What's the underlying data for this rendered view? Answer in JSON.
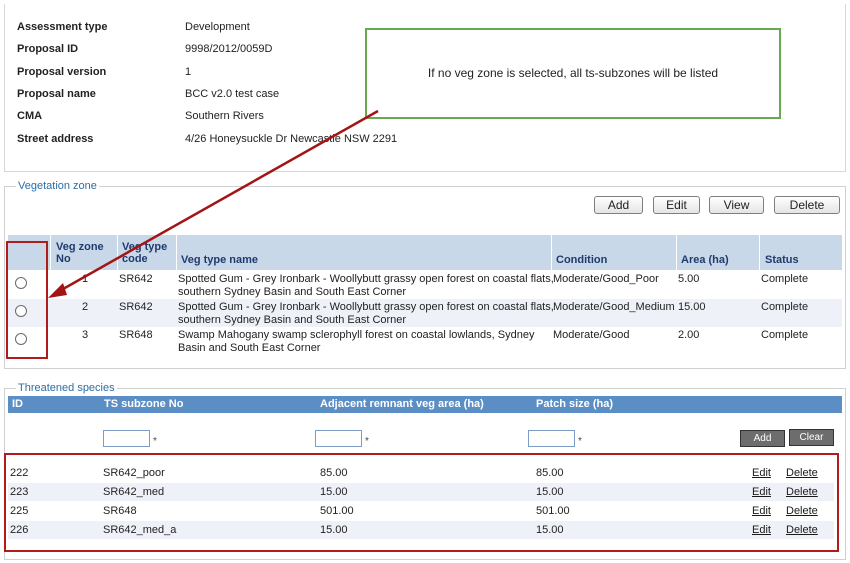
{
  "details": [
    {
      "label": "Assessment type",
      "value": "Development"
    },
    {
      "label": "Proposal ID",
      "value": "9998/2012/0059D"
    },
    {
      "label": "Proposal version",
      "value": "1"
    },
    {
      "label": "Proposal name",
      "value": "BCC v2.0 test case"
    },
    {
      "label": "CMA",
      "value": "Southern Rivers"
    },
    {
      "label": "Street address",
      "value": "4/26 Honeysuckle Dr Newcastle NSW 2291"
    }
  ],
  "callout": {
    "text": "If no veg zone is selected, all ts-subzones will be listed"
  },
  "veg_zone": {
    "legend": "Vegetation zone",
    "buttons": {
      "add": "Add",
      "edit": "Edit",
      "view": "View",
      "delete": "Delete"
    },
    "headers": {
      "zone_no": "Veg zone No",
      "type_code": "Veg type code",
      "type_name": "Veg type name",
      "condition": "Condition",
      "area": "Area (ha)",
      "status": "Status"
    },
    "rows": [
      {
        "zone_no": "1",
        "type_code": "SR642",
        "type_name_1": "Spotted Gum - Grey Ironbark - Woollybutt grassy open forest on coastal flats,",
        "type_name_2": "southern Sydney Basin and South East Corner",
        "condition": "Moderate/Good_Poor",
        "area": "5.00",
        "status": "Complete"
      },
      {
        "zone_no": "2",
        "type_code": "SR642",
        "type_name_1": "Spotted Gum - Grey Ironbark - Woollybutt grassy open forest on coastal flats,",
        "type_name_2": "southern Sydney Basin and South East Corner",
        "condition": "Moderate/Good_Medium",
        "area": "15.00",
        "status": "Complete"
      },
      {
        "zone_no": "3",
        "type_code": "SR648",
        "type_name_1": "Swamp Mahogany swamp sclerophyll forest on coastal lowlands, Sydney",
        "type_name_2": "Basin and South East Corner",
        "condition": "Moderate/Good",
        "area": "2.00",
        "status": "Complete"
      }
    ]
  },
  "threatened": {
    "legend": "Threatened species",
    "headers": {
      "id": "ID",
      "subzone": "TS subzone No",
      "adjacent": "Adjacent remnant veg area (ha)",
      "patch": "Patch size (ha)"
    },
    "filter": {
      "required_mark": "*",
      "add": "Add",
      "clear": "Clear"
    },
    "rows": [
      {
        "id": "222",
        "subzone": "SR642_poor",
        "adjacent": "85.00",
        "patch": "85.00"
      },
      {
        "id": "223",
        "subzone": "SR642_med",
        "adjacent": "15.00",
        "patch": "15.00"
      },
      {
        "id": "225",
        "subzone": "SR648",
        "adjacent": "501.00",
        "patch": "501.00"
      },
      {
        "id": "226",
        "subzone": "SR642_med_a",
        "adjacent": "15.00",
        "patch": "15.00"
      }
    ],
    "row_links": {
      "edit": "Edit",
      "delete": "Delete"
    }
  },
  "colors": {
    "accent": "#5b8ec5",
    "callout_border": "#6aa84f",
    "highlight_red": "#b01c1c",
    "legend": "#2b6ea8"
  }
}
